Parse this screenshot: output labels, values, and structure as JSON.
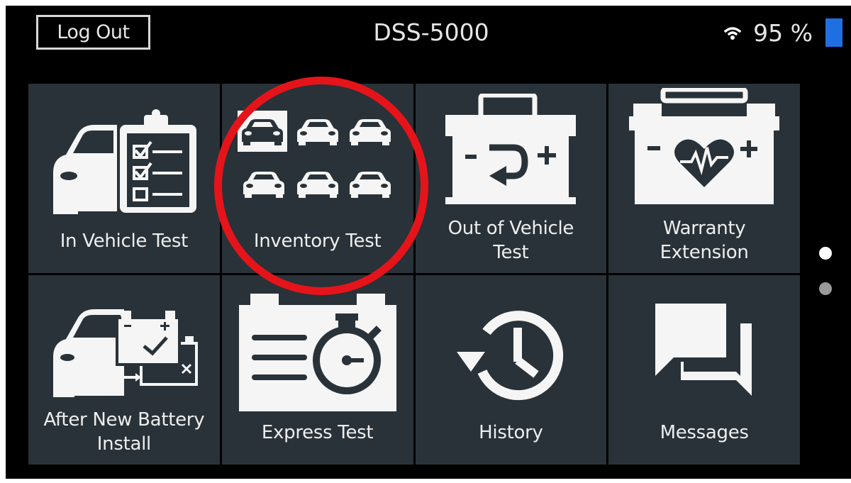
{
  "header": {
    "logout_label": "Log Out",
    "device_title": "DSS-5000",
    "battery_percent": "95 %",
    "battery_level": 0.95,
    "wifi_icon": "wifi-icon"
  },
  "menu": {
    "tiles": [
      {
        "label": "In Vehicle Test",
        "icon": "in-vehicle-test-icon"
      },
      {
        "label": "Inventory Test",
        "icon": "inventory-test-icon"
      },
      {
        "label": "Out of Vehicle\nTest",
        "icon": "out-of-vehicle-test-icon"
      },
      {
        "label": "Warranty\nExtension",
        "icon": "warranty-extension-icon"
      },
      {
        "label": "After New Battery\nInstall",
        "icon": "after-new-battery-install-icon"
      },
      {
        "label": "Express Test",
        "icon": "express-test-icon"
      },
      {
        "label": "History",
        "icon": "history-icon"
      },
      {
        "label": "Messages",
        "icon": "messages-icon"
      }
    ]
  },
  "pagination": {
    "pages": 2,
    "current": 1
  },
  "colors": {
    "background": "#000000",
    "tile": "#293238",
    "accent_battery": "#1f6fe0",
    "highlight": "#e5141b",
    "text": "#eeeeee"
  }
}
